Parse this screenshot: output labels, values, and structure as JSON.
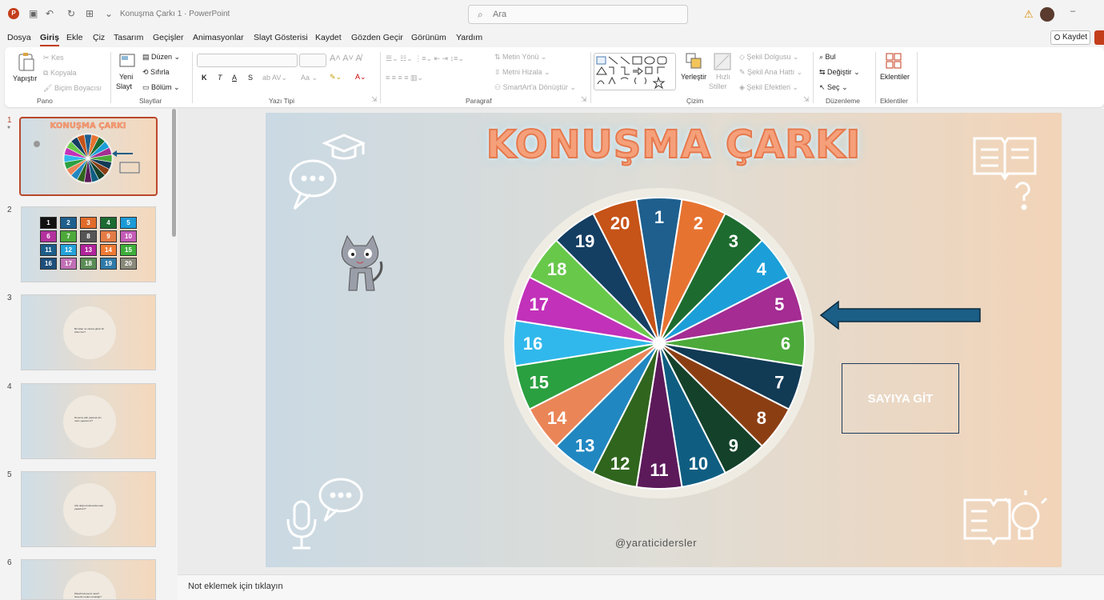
{
  "titlebar": {
    "doc_title": "Konuşma Çarkı 1 · PowerPoint",
    "search_placeholder": "Ara",
    "app_letter": "P"
  },
  "menu": {
    "items": [
      "Dosya",
      "Giriş",
      "Ekle",
      "Çiz",
      "Tasarım",
      "Geçişler",
      "Animasyonlar",
      "Slayt Gösterisi",
      "Kaydet",
      "Gözden Geçir",
      "Görünüm",
      "Yardım"
    ],
    "active": "Giriş",
    "save_label": "Kaydet"
  },
  "ribbon": {
    "pano": {
      "paste": "Yapıştır",
      "cut": "Kes",
      "copy": "Kopyala",
      "format_painter": "Biçim Boyacısı",
      "label": "Pano"
    },
    "slaytlar": {
      "new_slide_1": "Yeni",
      "new_slide_2": "Slayt",
      "layout": "Düzen",
      "reset": "Sıfırla",
      "section": "Bölüm",
      "label": "Slaytlar"
    },
    "yazi_tipi": {
      "bold": "K",
      "italic": "T",
      "underline": "A",
      "strike": "S",
      "label": "Yazı Tipi",
      "case": "Aa"
    },
    "paragraf": {
      "text_direction": "Metin Yönü",
      "align_text": "Metni Hizala",
      "smartart": "SmartArt'a Dönüştür",
      "label": "Paragraf"
    },
    "cizim": {
      "arrange": "Yerleştir",
      "quick_styles_1": "Hızlı",
      "quick_styles_2": "Stiller",
      "fill": "Şekil Dolgusu",
      "outline": "Şekil Ana Hattı",
      "effects": "Şekil Efektleri",
      "label": "Çizim"
    },
    "duzenleme": {
      "find": "Bul",
      "replace": "Değiştir",
      "select": "Seç",
      "label": "Düzenleme"
    },
    "eklentiler": {
      "addins": "Eklentiler",
      "label": "Eklentiler"
    }
  },
  "slides_panel": {
    "numbers": [
      "1",
      "2",
      "3",
      "4",
      "5",
      "6"
    ],
    "grid_cells": [
      "1",
      "2",
      "3",
      "4",
      "5",
      "6",
      "7",
      "8",
      "9",
      "10",
      "11",
      "12",
      "13",
      "14",
      "15",
      "16",
      "17",
      "18",
      "19",
      "20"
    ],
    "grid_colors": [
      "#111111",
      "#1e5f8e",
      "#e06b2b",
      "#1c6b32",
      "#1b9ad6",
      "#b3319d",
      "#4ca93a",
      "#555555",
      "#e37b45",
      "#c45cb7",
      "#1b5e8a",
      "#24a2d9",
      "#b1249b",
      "#ef7b33",
      "#3fae3b",
      "#1d4e7b",
      "#c06fb5",
      "#5b8c56",
      "#2f7aa8",
      "#8a8a7a"
    ],
    "thumb_texts": [
      "Bir tatan ne olsuna güzel bir zillen ilon?",
      "Deneme tatlı yapmak için neler yaparsınız?",
      "Afis doğru Antarsında neler yaşadınız?",
      "Pikachi kimseniz nasıl? Sevenis neden olmadığı?"
    ]
  },
  "slide": {
    "title": "KONUŞMA ÇARKI",
    "handle": "@yaraticidersler",
    "button_label": "SAYIYA GİT",
    "wheel_numbers": [
      "1",
      "2",
      "3",
      "4",
      "5",
      "6",
      "7",
      "8",
      "9",
      "10",
      "11",
      "12",
      "13",
      "14",
      "15",
      "16",
      "17",
      "18",
      "19",
      "20"
    ],
    "wheel_colors": [
      "#1e5f8e",
      "#e77331",
      "#1d6b2f",
      "#1c9fd8",
      "#a42c92",
      "#4ca93a",
      "#113a55",
      "#8c3e13",
      "#14412a",
      "#0f5e82",
      "#5c1a5a",
      "#30651e",
      "#2187c1",
      "#ea8558",
      "#2aa040",
      "#30b8ec",
      "#c231b9",
      "#68c84a",
      "#143e62",
      "#c65317"
    ],
    "pointer_color": "#1b5e86"
  },
  "notes": {
    "placeholder": "Not eklemek için tıklayın"
  }
}
